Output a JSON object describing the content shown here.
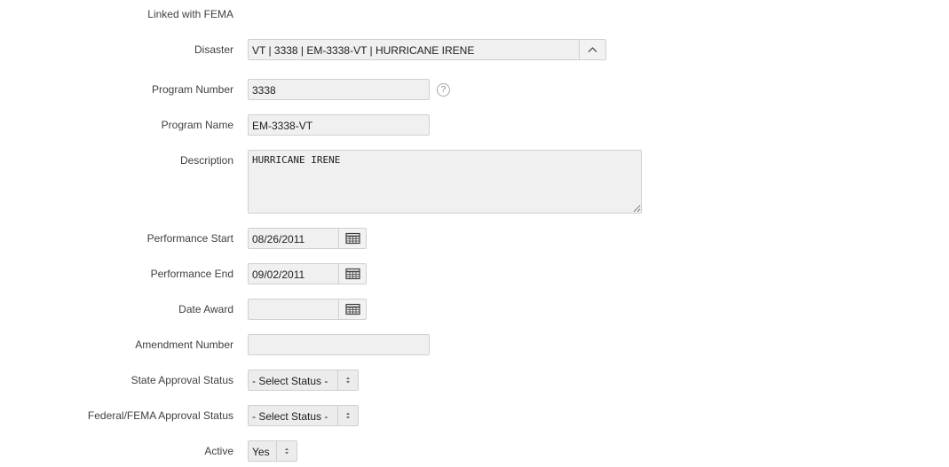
{
  "form": {
    "linked_with_fema_label": "Linked with FEMA",
    "disaster": {
      "label": "Disaster",
      "value": "VT | 3338 | EM-3338-VT | HURRICANE IRENE",
      "icon": "chevron-up-icon"
    },
    "program_number": {
      "label": "Program Number",
      "value": "3338",
      "help_glyph": "?"
    },
    "program_name": {
      "label": "Program Name",
      "value": "EM-3338-VT"
    },
    "description": {
      "label": "Description",
      "value": "HURRICANE IRENE"
    },
    "performance_start": {
      "label": "Performance Start",
      "value": "08/26/2011",
      "icon": "calendar-icon"
    },
    "performance_end": {
      "label": "Performance End",
      "value": "09/02/2011",
      "icon": "calendar-icon"
    },
    "date_award": {
      "label": "Date Award",
      "value": "",
      "icon": "calendar-icon"
    },
    "amendment_number": {
      "label": "Amendment Number",
      "value": ""
    },
    "state_approval_status": {
      "label": "State Approval Status",
      "value": "- Select Status -"
    },
    "federal_approval_status": {
      "label": "Federal/FEMA Approval Status",
      "value": "- Select Status -"
    },
    "active": {
      "label": "Active",
      "value": "Yes"
    }
  }
}
